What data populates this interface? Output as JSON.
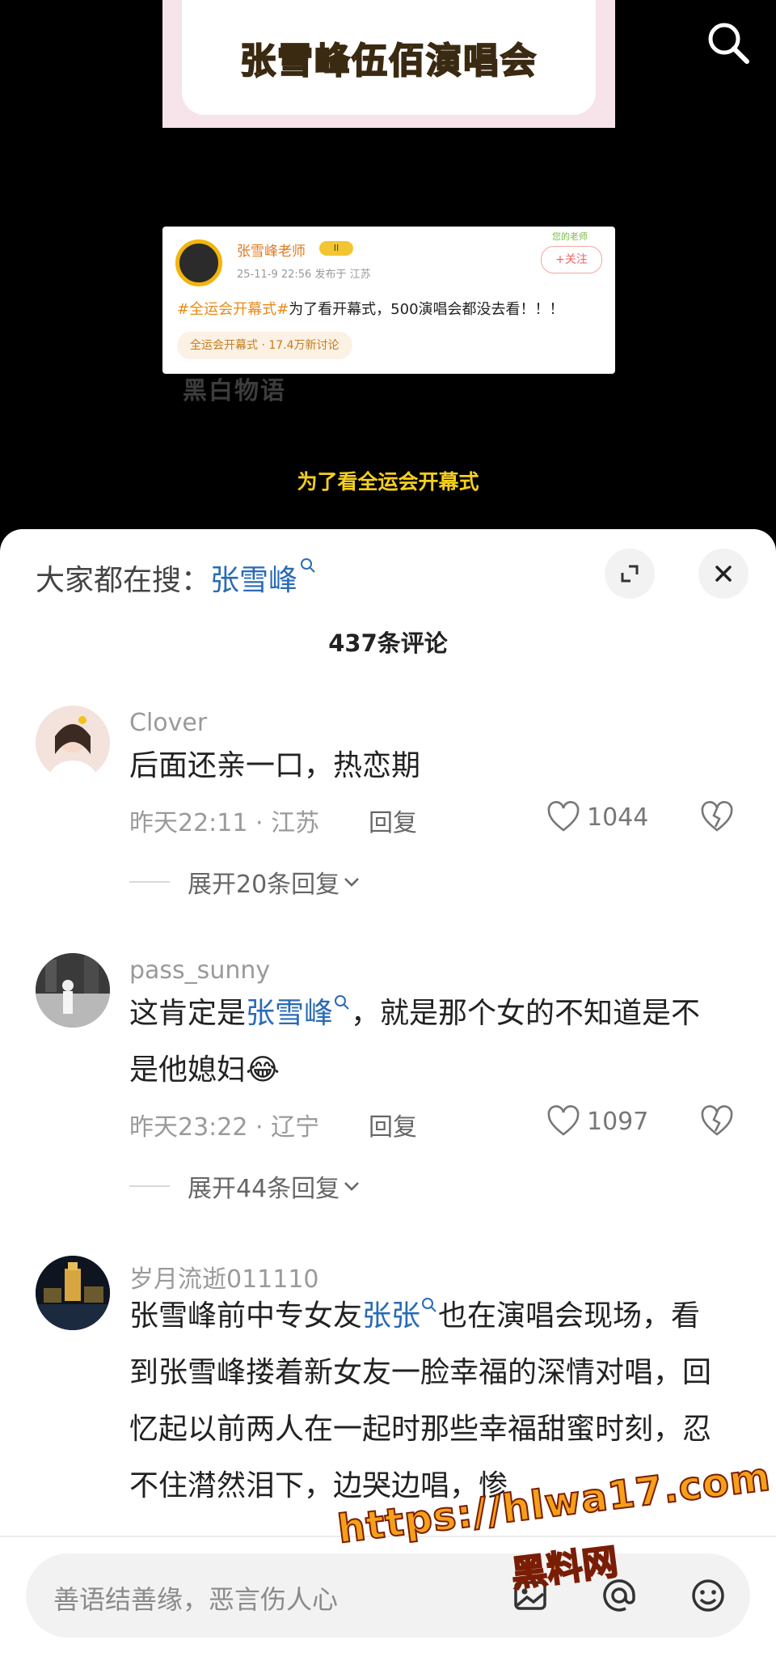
{
  "video": {
    "banner_title": "张雪峰伍佰演唱会",
    "post_card": {
      "author": "张雪峰老师",
      "badge": "II",
      "meta": "25-11-9 22:56  发布于 江苏",
      "follow": "+关注",
      "sticker": "您的老师",
      "hashtag": "#全运会开幕式#",
      "text": "为了看开幕式，500演唱会都没去看！！！",
      "topic": "全运会开幕式 · 17.4万新讨论"
    },
    "watermark": "黑白物语",
    "subtitle": "为了看全运会开幕式"
  },
  "sheet": {
    "hot_search_label": "大家都在搜：",
    "hot_search_keyword": "张雪峰",
    "comment_count": "437条评论",
    "reply_label": "回复",
    "comments": [
      {
        "username": "Clover",
        "text": "后面还亲一口，热恋期",
        "meta": "昨天22:11 · 江苏",
        "likes": "1044",
        "expand": "展开20条回复"
      },
      {
        "username": "pass_sunny",
        "text_before": "这肯定是",
        "link": "张雪峰",
        "text_after": "，就是那个女的不知道是不是他媳妇",
        "emoji": "😂",
        "meta": "昨天23:22 · 辽宁",
        "likes": "1097",
        "expand": "展开44条回复"
      },
      {
        "username": "岁月流逝011110",
        "text_before": "张雪峰前中专女友",
        "link": "张张",
        "text_after": "也在演唱会现场，看到张雪峰搂着新女友一脸幸福的深情对唱，回忆起以前两人在一起时那些幸福甜蜜时刻，忍不住潸然泪下，边哭边唱，惨"
      }
    ],
    "input_placeholder": "善语结善缘，恶言伤人心"
  },
  "overlay_watermark": {
    "url": "https://hlwa17.com",
    "site": "黑料网"
  }
}
